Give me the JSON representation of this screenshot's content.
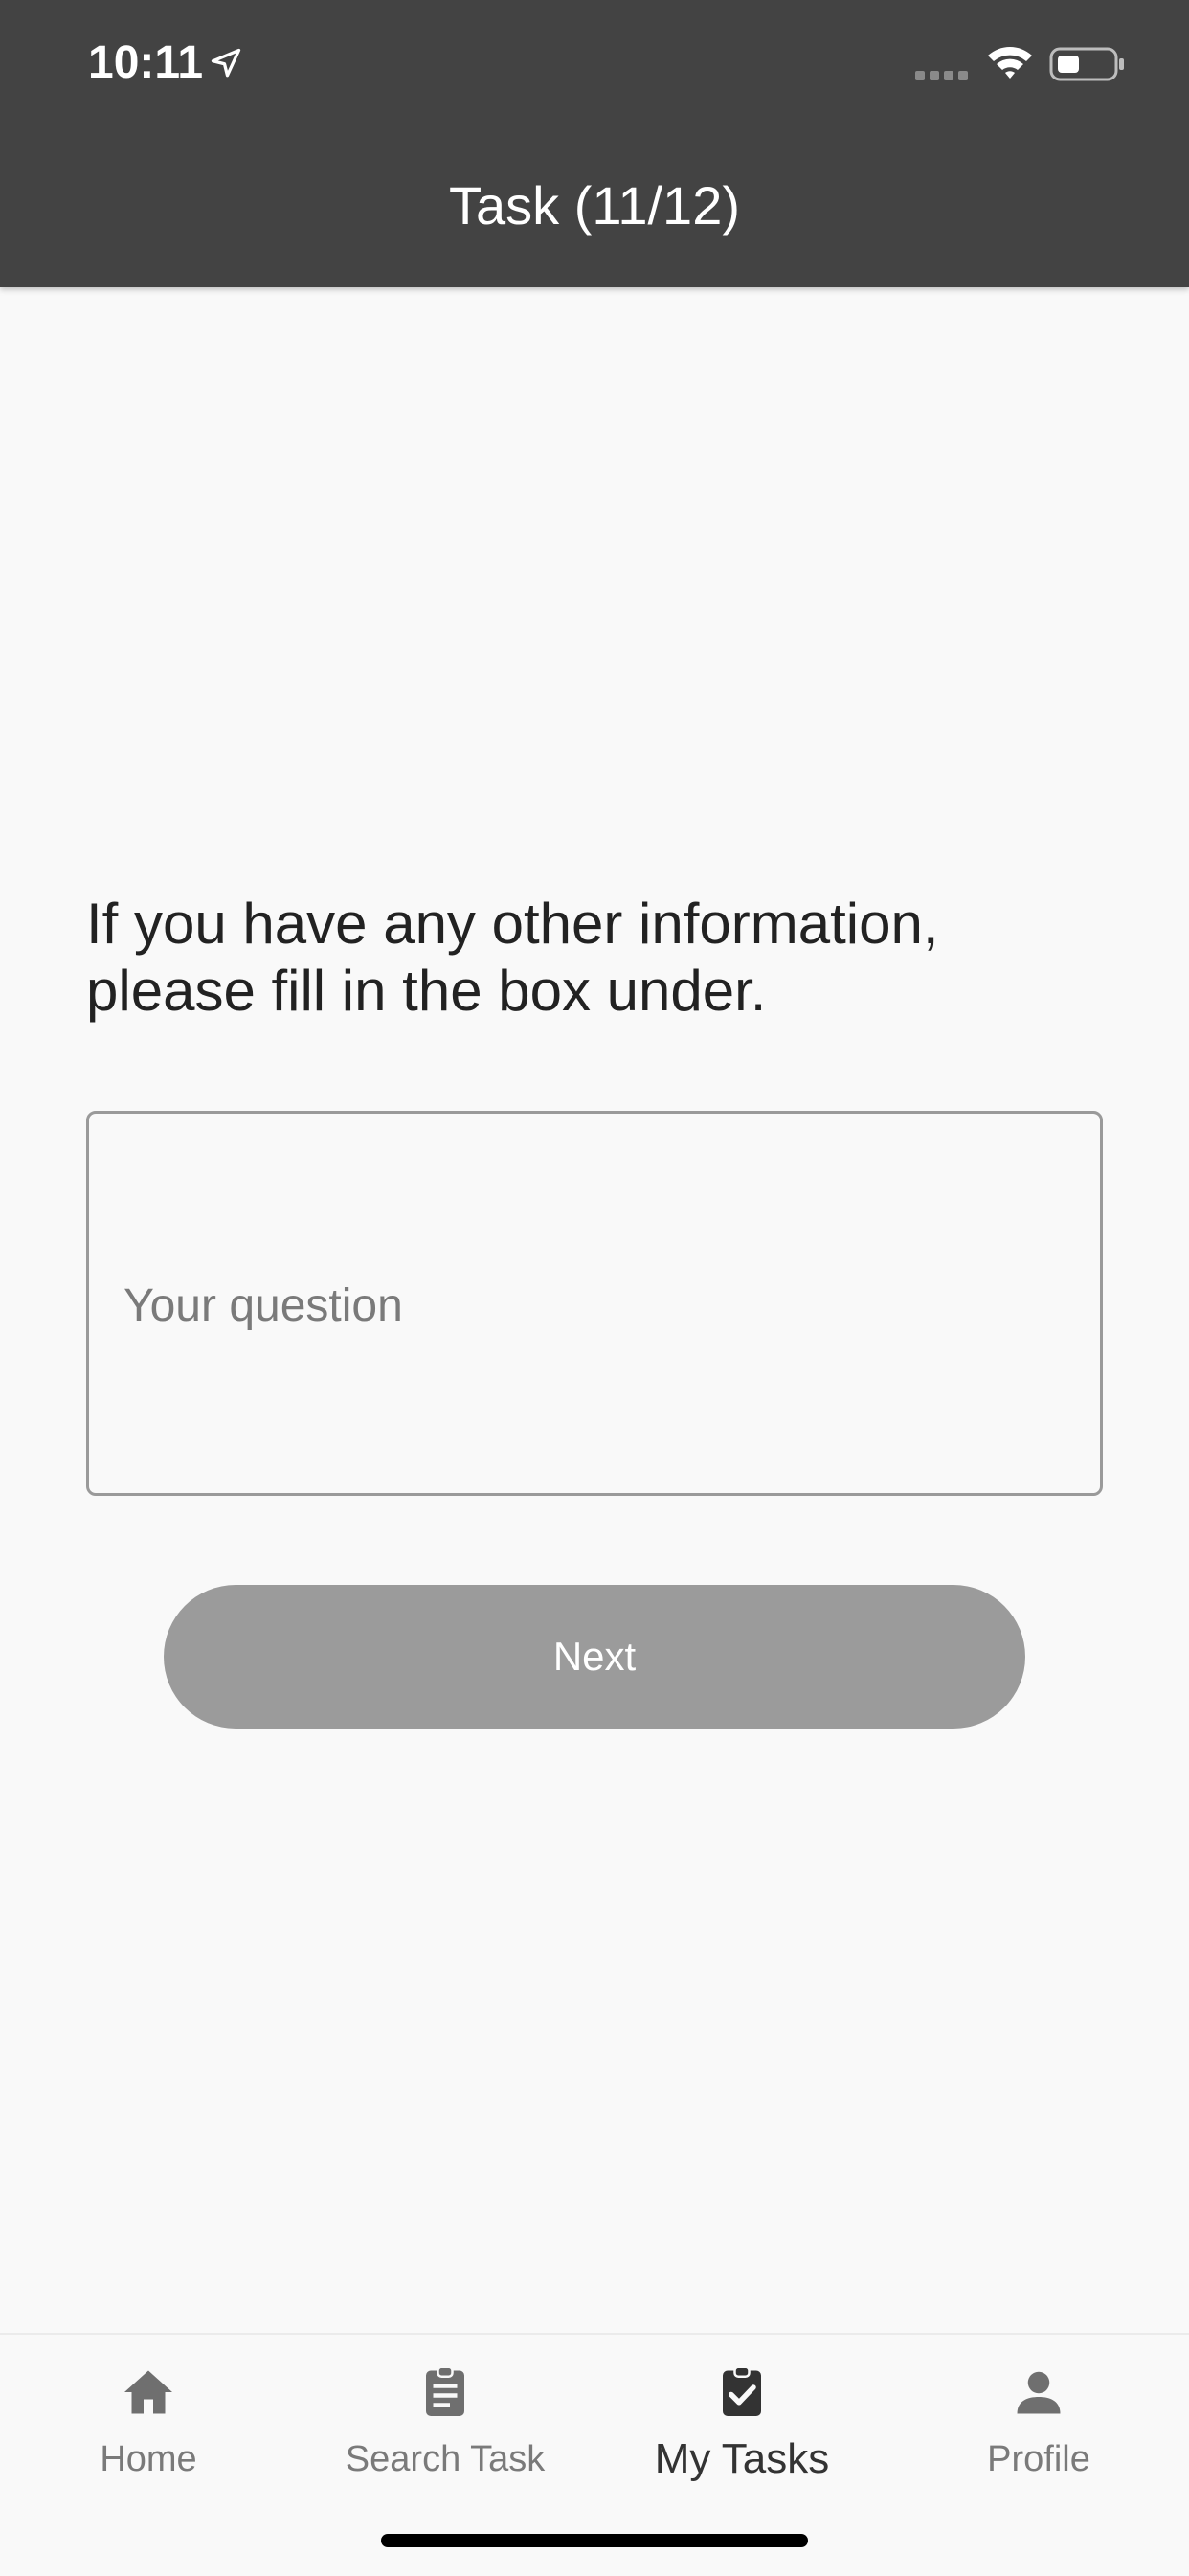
{
  "status_bar": {
    "time": "10:11"
  },
  "header": {
    "title": "Task (11/12)"
  },
  "question": {
    "text": "If you have any other information, please fill in the box under."
  },
  "answer": {
    "placeholder": "Your question",
    "value": ""
  },
  "actions": {
    "next_label": "Next"
  },
  "tabbar": {
    "items": [
      {
        "label": "Home",
        "icon": "home-icon"
      },
      {
        "label": "Search Task",
        "icon": "clipboard-icon"
      },
      {
        "label": "My Tasks",
        "icon": "clipboard-check-icon",
        "active": true
      },
      {
        "label": "Profile",
        "icon": "person-icon"
      }
    ]
  },
  "colors": {
    "header_bg": "#434343",
    "button_bg": "#9b9b9b",
    "page_bg": "#f9f9f9"
  }
}
